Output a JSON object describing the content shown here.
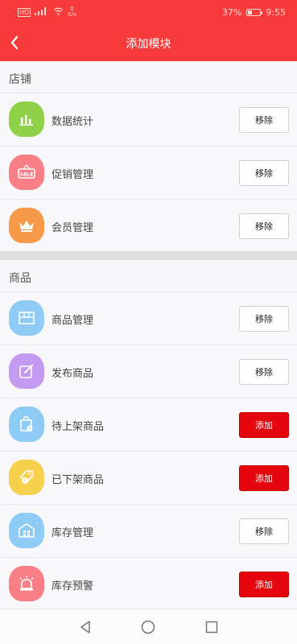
{
  "status_bar": {
    "carrier": "HD",
    "net_speed_value": "0",
    "net_speed_unit": "K/s",
    "battery": "37%",
    "battery_level": 0.37,
    "time": "9:55"
  },
  "header": {
    "title": "添加模块",
    "bg_color": "#f73a3a"
  },
  "sections": [
    {
      "title": "店铺",
      "items": [
        {
          "label": "数据统计",
          "icon": "bar-chart-icon",
          "color": "#8fd24a",
          "action": "移除",
          "state": "remove"
        },
        {
          "label": "促销管理",
          "icon": "sale-tag-icon",
          "color": "#f87f86",
          "action": "移除",
          "state": "remove"
        },
        {
          "label": "会员管理",
          "icon": "crown-icon",
          "color": "#f69a4a",
          "action": "移除",
          "state": "remove"
        }
      ]
    },
    {
      "title": "商品",
      "items": [
        {
          "label": "商品管理",
          "icon": "package-box-icon",
          "color": "#8ecbf5",
          "action": "移除",
          "state": "remove"
        },
        {
          "label": "发布商品",
          "icon": "edit-icon",
          "color": "#c39af0",
          "action": "移除",
          "state": "remove"
        },
        {
          "label": "待上架商品",
          "icon": "shopping-bag-icon",
          "color": "#8ecbf5",
          "action": "添加",
          "state": "add"
        },
        {
          "label": "已下架商品",
          "icon": "tag-clock-icon",
          "color": "#f5d14e",
          "action": "添加",
          "state": "add"
        },
        {
          "label": "库存管理",
          "icon": "warehouse-icon",
          "color": "#8ecbf5",
          "action": "移除",
          "state": "remove"
        },
        {
          "label": "库存预警",
          "icon": "alarm-light-icon",
          "color": "#f87f86",
          "action": "添加",
          "state": "add"
        }
      ]
    }
  ],
  "colors": {
    "add_button": "#e5060d",
    "remove_button": "#ffffff"
  },
  "navigation_bar": {
    "back": "triangle-back-icon",
    "home": "circle-home-icon",
    "recents": "square-recents-icon"
  }
}
